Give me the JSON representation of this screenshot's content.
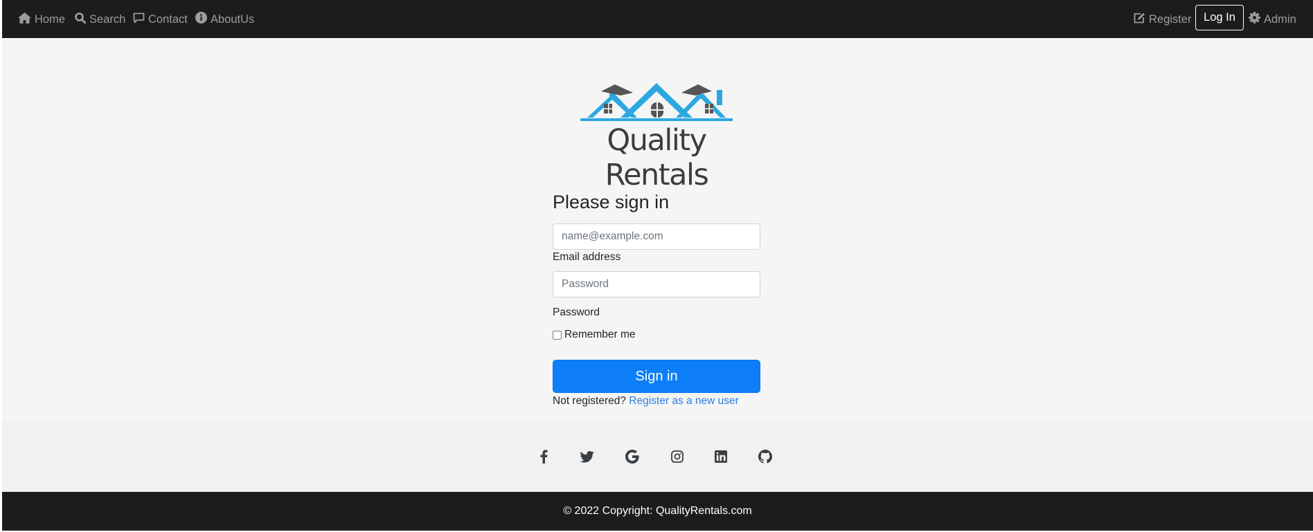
{
  "nav": {
    "left_items": [
      {
        "label": "Home",
        "icon": "home-icon"
      },
      {
        "label": "Search",
        "icon": "search-icon"
      },
      {
        "label": "Contact",
        "icon": "chat-icon"
      },
      {
        "label": "AboutUs",
        "icon": "info-icon"
      }
    ],
    "register_label": "Register",
    "register_icon": "edit-icon",
    "login_label": "Log In",
    "admin_label": "Admin",
    "admin_icon": "gear-icon"
  },
  "logo": {
    "text": "Quality Rentals",
    "roof_color": "#2ca8e0",
    "text_color": "#3d3d3d"
  },
  "form": {
    "title": "Please sign in",
    "email_placeholder": "name@example.com",
    "email_value": "",
    "email_label": "Email address",
    "password_placeholder": "Password",
    "password_value": "",
    "password_label": "Password",
    "remember_label": "Remember me",
    "remember_checked": false,
    "submit_label": "Sign in",
    "not_registered": "Not registered?",
    "register_link": "Register as a new user",
    "button_color": "#0d7ef7"
  },
  "social": {
    "icons": [
      "facebook-icon",
      "twitter-icon",
      "google-icon",
      "instagram-icon",
      "linkedin-icon",
      "github-icon"
    ]
  },
  "footer": {
    "copyright": "© 2022 Copyright: QualityRentals.com"
  }
}
